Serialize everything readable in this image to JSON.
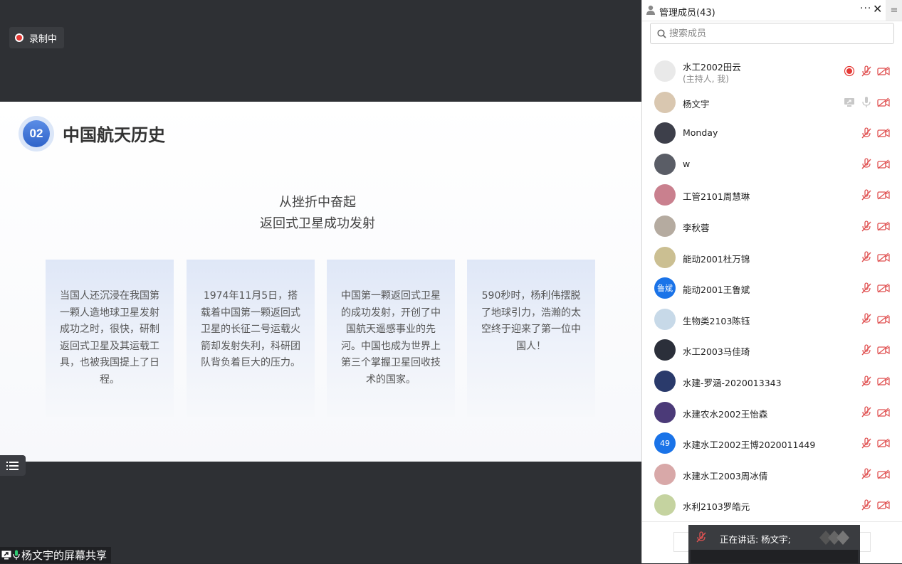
{
  "recording": {
    "label": "录制中"
  },
  "slide": {
    "number": "02",
    "title": "中国航天历史",
    "subtitle_line1": "从挫折中奋起",
    "subtitle_line2": "返回式卫星成功发射",
    "cards": [
      {
        "text": "当国人还沉浸在我国第一颗人造地球卫星发射成功之时，很快，研制返回式卫星及其运载工具，也被我国提上了日程。"
      },
      {
        "text": "1974年11月5日，搭载着中国第一颗返回式卫星的长征二号运载火箭却发射失利，科研团队背负着巨大的压力。"
      },
      {
        "text": "中国第一颗返回式卫星的成功发射，开创了中国航天遥感事业的先河。中国也成为世界上第三个掌握卫星回收技术的国家。"
      },
      {
        "text": "590秒时，杨利伟摆脱了地球引力，浩瀚的太空终于迎来了第一位中国人！"
      }
    ]
  },
  "share_bar": {
    "label": "杨文宇的屏幕共享"
  },
  "panel": {
    "title": "管理成员(43)",
    "more": "···",
    "close": "✕",
    "side": "≡",
    "search_placeholder": "搜索成员"
  },
  "members": [
    {
      "name": "水工2002田云",
      "sub": "(主持人, 我)",
      "avatar_color": "#e9e9e9",
      "avatar_text": "",
      "recording": true
    },
    {
      "name": "杨文宇",
      "sub": "",
      "avatar_color": "#d9c7b0",
      "avatar_text": "",
      "sharing": true
    },
    {
      "name": "Monday",
      "sub": "",
      "avatar_color": "#3d3f4a",
      "avatar_text": ""
    },
    {
      "name": "w",
      "sub": "",
      "avatar_color": "#5a5d66",
      "avatar_text": ""
    },
    {
      "name": "工管2101周慧琳",
      "sub": "",
      "avatar_color": "#c9808e",
      "avatar_text": ""
    },
    {
      "name": "李秋蓉",
      "sub": "",
      "avatar_color": "#b5aba0",
      "avatar_text": ""
    },
    {
      "name": "能动2001杜万锦",
      "sub": "",
      "avatar_color": "#cbbf92",
      "avatar_text": ""
    },
    {
      "name": "能动2001王鲁斌",
      "sub": "",
      "avatar_color": "#1a73e8",
      "avatar_text": "鲁斌"
    },
    {
      "name": "生物类2103陈钰",
      "sub": "",
      "avatar_color": "#c7d9e8",
      "avatar_text": ""
    },
    {
      "name": "水工2003马佳琦",
      "sub": "",
      "avatar_color": "#2b2f3a",
      "avatar_text": ""
    },
    {
      "name": "水建-罗涵-2020013343",
      "sub": "",
      "avatar_color": "#2a3a6b",
      "avatar_text": ""
    },
    {
      "name": "水建农水2002王怡森",
      "sub": "",
      "avatar_color": "#4b3a78",
      "avatar_text": ""
    },
    {
      "name": "水建水工2002王博2020011449",
      "sub": "",
      "avatar_color": "#1a73e8",
      "avatar_text": "49"
    },
    {
      "name": "水建水工2003周冰倩",
      "sub": "",
      "avatar_color": "#d8a8a8",
      "avatar_text": ""
    },
    {
      "name": "水利2103罗皓元",
      "sub": "",
      "avatar_color": "#c5d3a0",
      "avatar_text": ""
    }
  ],
  "speaking": {
    "label": "正在讲话: 杨文宇;"
  },
  "colors": {
    "accent": "#1a73e8",
    "record_red": "#e53935",
    "mute_red": "#e05252",
    "icon_gray": "#c8c8c8"
  }
}
